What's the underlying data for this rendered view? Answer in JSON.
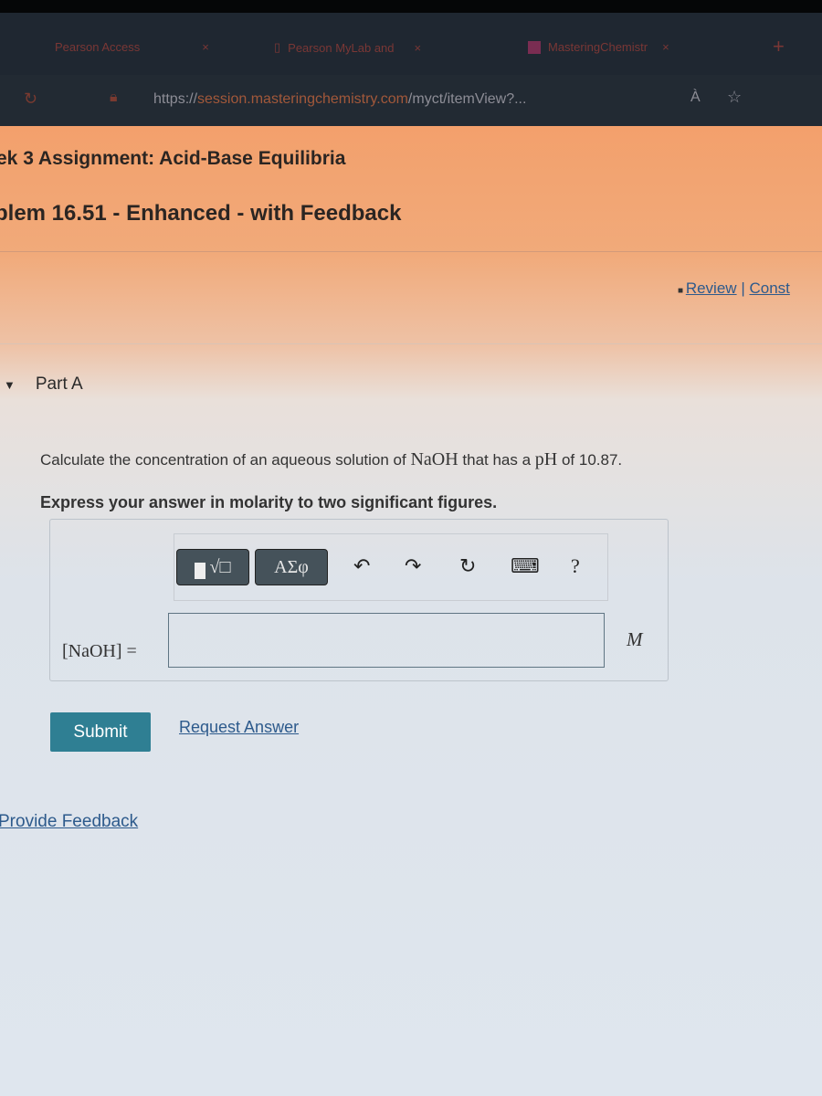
{
  "browser": {
    "tabs": [
      {
        "label": "Pearson Access"
      },
      {
        "label": "Pearson MyLab and"
      },
      {
        "label": "MasteringChemistr"
      }
    ],
    "close_glyph": "×",
    "new_tab_glyph": "+",
    "url_prefix": "https://",
    "url_domain": "session.masteringchemistry.com",
    "url_path": "/myct/itemView?...",
    "read_aloud": "À"
  },
  "page": {
    "assignment_title": "ek 3 Assignment: Acid-Base Equilibria",
    "problem_title": "blem 16.51 - Enhanced - with Feedback",
    "review_link": "Review",
    "separator": "|",
    "constants_link": "Const",
    "part_label": "Part A",
    "question": {
      "pre": "Calculate the concentration of an aqueous solution of ",
      "species": "NaOH",
      "mid": " that has a ",
      "ph": "pH",
      "post": " of 10.87."
    },
    "instruction": "Express your answer in molarity to two significant figures.",
    "toolbar": {
      "templates_label": "√□",
      "greek_label": "ΑΣφ",
      "undo": "↶",
      "redo": "↷",
      "reset": "↻",
      "keyboard": "⌨",
      "help": "?"
    },
    "answer_label": "[NaOH] =",
    "answer_value": "",
    "unit": "M",
    "submit": "Submit",
    "request_answer": "Request Answer",
    "feedback": "Provide Feedback"
  }
}
